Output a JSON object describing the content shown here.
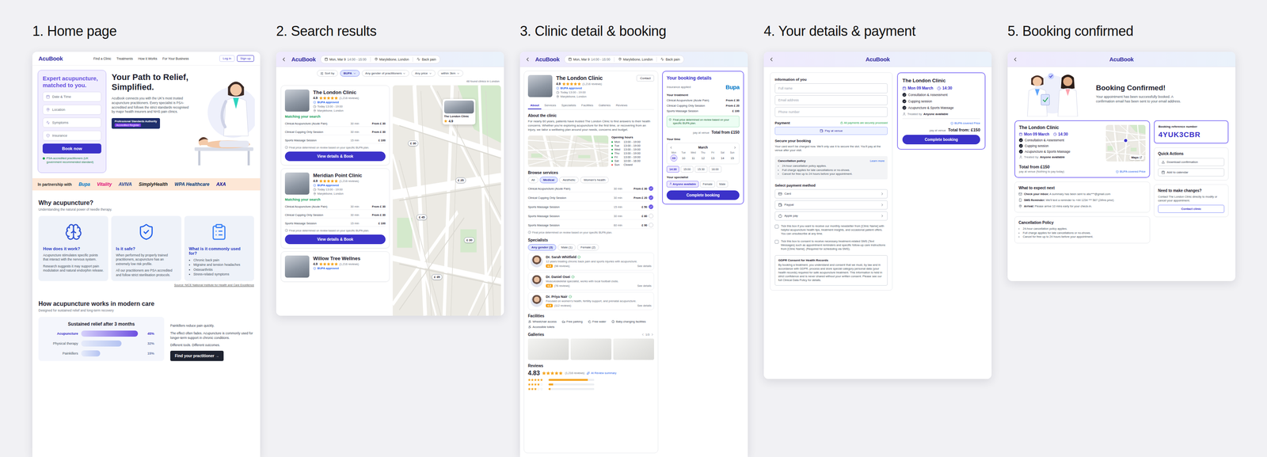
{
  "steps": [
    "1. Home page",
    "2. Search results",
    "3. Clinic detail & booking",
    "4. Your details & payment",
    "5. Booking confirmed"
  ],
  "logo": "AcuBook",
  "home": {
    "nav": [
      "Find a Clinic",
      "Treatments",
      "How it Works",
      "For Your Business"
    ],
    "login": "Log in",
    "signup": "Sign up",
    "search_card": {
      "title": "Expert acupuncture, matched to you.",
      "fields": [
        "Date & Time",
        "Location",
        "Symptoms",
        "Insurance"
      ],
      "button": "Book now",
      "note": "PSA-accredited practitioners (UK government recommended standard)"
    },
    "hero": {
      "title": "Your Path to Relief, Simplified.",
      "text": "AcuBook connects you with the UK's most trusted acupuncture practitioners. Every specialist is PSA-accredited and follows the strict standards recognised by major health insurers and NHS pain clinics.",
      "badge_top": "Professional Standards Authority",
      "badge_bottom": "Accredited Register"
    },
    "partners": {
      "label": "In partnership with",
      "logos": [
        {
          "name": "Bupa",
          "color": "#0079c8"
        },
        {
          "name": "Vitality",
          "color": "#e0147c"
        },
        {
          "name": "AVIVA",
          "color": "#1d3f8f"
        },
        {
          "name": "SimplyHealth",
          "color": "#222222"
        },
        {
          "name": "WPA Healthcare",
          "color": "#0a3d7a"
        },
        {
          "name": "AXA",
          "color": "#00008f"
        }
      ]
    },
    "why": {
      "title": "Why acupuncture?",
      "subtitle": "Understanding the natural power of needle therapy.",
      "cards": [
        {
          "title": "How does it work?",
          "kind": "text",
          "paragraphs": [
            "Acupuncture stimulates specific points that interact with the nervous system.",
            "Research suggests it may support pain modulation and natural endorphin release."
          ]
        },
        {
          "title": "Is it safe?",
          "kind": "text",
          "paragraphs": [
            "When performed by properly trained practitioners, acupuncture has an extremely low risk profile.",
            "All our practitioners are PSA accredited and follow strict sterilisation protocols."
          ]
        },
        {
          "title": "What is it commonly used for?",
          "kind": "list",
          "paragraphs": [
            "Chronic back pain",
            "Migraine and tension headaches",
            "Osteoarthritis",
            "Stress-related symptoms"
          ]
        }
      ],
      "source": "Source: NICE National Institute for Health and Care Excellence"
    },
    "care": {
      "title": "How acupuncture works in modern care",
      "subtitle": "Designed for sustained relief and long-term recovery",
      "chart": {
        "title": "Sustained relief after 3 months",
        "series": [
          {
            "label": "Acupuncture",
            "values": [
              45
            ],
            "reading": "45%",
            "highlight": true
          },
          {
            "label": "Physical therapy",
            "values": [
              32
            ],
            "reading": "32%",
            "highlight": false
          },
          {
            "label": "Painkillers",
            "values": [
              15
            ],
            "reading": "15%",
            "highlight": false
          }
        ]
      },
      "paragraphs": [
        "Painkillers reduce pain quickly.",
        "The effect often fades. Acupuncture is commonly used for longer-term support in chronic conditions.",
        "Different tools. Different outcomes."
      ],
      "button": "Find your practitioner →"
    }
  },
  "search": {
    "query": {
      "date": "Mon, Mar 9",
      "time": "14:00 - 15:00",
      "location": "Marylebone, London",
      "symptom": "Back pain"
    },
    "filters": [
      {
        "label": "Sort by",
        "selected": false
      },
      {
        "label": "BUPA",
        "selected": true
      },
      {
        "label": "Any gender of practitioners",
        "selected": false
      },
      {
        "label": "Any price",
        "selected": false
      },
      {
        "label": "within 3km",
        "selected": false
      }
    ],
    "count": "48 found clinics in London",
    "clinics": [
      {
        "kind": "full",
        "name": "The London Clinic",
        "rating": "4.9",
        "stars": 5,
        "reviews": "(1,216 reviews)",
        "badge": "BUPA approved",
        "hours": "Today 13:00 - 19:00",
        "location": "Marylebone, London",
        "match": "Matching your search",
        "services": [
          {
            "name": "Clinical Acupuncture (Acute Pain)",
            "duration": "30 min",
            "price": "From £ 30"
          },
          {
            "name": "Clinical Cupping Only Session",
            "duration": "30 min",
            "price": "From £ 30"
          },
          {
            "name": "Sports Massage Session",
            "duration": "15 min",
            "price": "£ 100"
          }
        ],
        "note": "Final price determined on review based on your specific BUPA plan.",
        "button": "View details & Book"
      },
      {
        "kind": "full",
        "name": "Meridian Point Clinic",
        "rating": "4.9",
        "stars": 5,
        "reviews": "(1,216 reviews)",
        "badge": "BUPA approved",
        "hours": "Today 13:00 - 19:00",
        "location": "Marylebone, London",
        "match": "Matching your search",
        "services": [
          {
            "name": "Clinical Acupuncture (Acute Pain)",
            "duration": "30 min",
            "price": "From £ 30"
          },
          {
            "name": "Clinical Cupping Only Session",
            "duration": "30 min",
            "price": "From £ 30"
          },
          {
            "name": "Sports Massage Session",
            "duration": "15 min",
            "price": "£ 100"
          }
        ],
        "note": "Final price determined on review based on your specific BUPA plan.",
        "button": "View details & Book"
      },
      {
        "kind": "partial",
        "name": "Willow Tree Wellnes",
        "rating": "4.9",
        "stars": 5,
        "reviews": "(1,216 reviews)",
        "badge": "BUPA approved"
      }
    ],
    "map": {
      "pins": [
        "£ 30",
        "£ 25",
        "£ 45",
        "£ 30",
        "£ 35"
      ],
      "popup": {
        "name": "The London Clinic",
        "rating": "4.9"
      }
    }
  },
  "detail": {
    "query": {
      "date": "Mon, Mar 9",
      "time": "14:00 - 15:00",
      "location": "Marylebone, London",
      "symptom": "Back pain"
    },
    "clinic": {
      "name": "The London Clinic",
      "rating": "4.9",
      "stars": 5,
      "reviews": "(1,216 reviews)",
      "badge": "BUPA approved",
      "hours": "Today 13:00 - 19:00",
      "location": "Marylebone, London"
    },
    "contact": "Contact",
    "tabs": [
      {
        "label": "About",
        "selected": true
      },
      {
        "label": "Services",
        "selected": false
      },
      {
        "label": "Specialists",
        "selected": false
      },
      {
        "label": "Facilities",
        "selected": false
      },
      {
        "label": "Galleries",
        "selected": false
      },
      {
        "label": "Reviews",
        "selected": false
      }
    ],
    "about": {
      "title": "About the clinic",
      "text": "For nearly 60 years, patients have trusted The London Clinic to find answers to their health concerns. Whether you're exploring acupuncture for the first time, or recovering from an injury, we tailor a wellbeing plan around your needs, concerns and budget."
    },
    "hours_title": "Opening hours",
    "hours": [
      {
        "day": "Mon",
        "time": "13:00 - 19:00"
      },
      {
        "day": "Tue",
        "time": "13:00 - 19:00"
      },
      {
        "day": "Wed",
        "time": "13:00 - 19:00"
      },
      {
        "day": "Thu",
        "time": "13:00 - 19:00"
      },
      {
        "day": "Fri",
        "time": "13:00 - 19:00"
      },
      {
        "day": "Sat",
        "time": "10:00 - 16:00"
      },
      {
        "day": "Sun",
        "time": "Closed"
      }
    ],
    "services": {
      "title": "Browse services",
      "chips": [
        {
          "label": "All",
          "selected": false
        },
        {
          "label": "Medical",
          "selected": true
        },
        {
          "label": "Aesthetic",
          "selected": false
        },
        {
          "label": "Women's health",
          "selected": false
        }
      ],
      "items": [
        {
          "name": "Clinical Acupuncture (Acute Pain)",
          "duration": "30 min",
          "price": "From £ 30",
          "checked": true
        },
        {
          "name": "Clinical Cupping Only Session",
          "duration": "30 min",
          "price": "From £ 20",
          "checked": true
        },
        {
          "name": "Sports Massage Session",
          "duration": "15 min",
          "price": "£ 50",
          "checked": true
        },
        {
          "name": "Sports Massage Session",
          "duration": "30 min",
          "price": "£ 80",
          "checked": false
        },
        {
          "name": "Sports Massage Session",
          "duration": "60 min",
          "price": "£ 90",
          "checked": false
        }
      ],
      "note": "Final price determined on review based on your specific BUPA plan."
    },
    "specialists": {
      "title": "Specialists",
      "chips": [
        {
          "label": "Any gender (3)",
          "selected": true
        },
        {
          "label": "Male (1)",
          "selected": false
        },
        {
          "label": "Female (2)",
          "selected": false
        }
      ],
      "people": [
        {
          "name": "Dr. Sarah Whitfield",
          "bio": "12 years treating chronic back pain and sports injuries with acupuncture.",
          "rating": "4.9",
          "reviews": "(98 reviews)",
          "link": "See details"
        },
        {
          "name": "Dr. Daniel Osei",
          "bio": "Musculoskeletal specialist, works with local football clubs.",
          "rating": "4.8",
          "reviews": "(76 reviews)",
          "link": "See details"
        },
        {
          "name": "Dr. Priya Nair",
          "bio": "Focused on women's health, fertility support, and prenatal acupuncture.",
          "rating": "4.9",
          "reviews": "(112 reviews)",
          "link": "See details"
        }
      ]
    },
    "facilities": {
      "title": "Facilities",
      "items": [
        "Wheelchair access",
        "Free parking",
        "Free water",
        "Baby changing facilities",
        "Accessible toilets"
      ]
    },
    "galleries": {
      "title": "Galleries",
      "pager": "1/3",
      "photos": 3
    },
    "reviews": {
      "title": "Reviews",
      "score": "4.83",
      "stars": 5,
      "count": "(1,216 reviews)",
      "summary": "AI Review summary",
      "bars": [
        {
          "stars": 5,
          "level": 0.86
        },
        {
          "stars": 4,
          "level": 0.1
        },
        {
          "stars": 3,
          "level": 0.04
        }
      ]
    },
    "booking": {
      "title": "Your booking details",
      "insurance_label": "Insurance applied",
      "insurer": "Bupa",
      "treatment_label": "Your treatment",
      "items": [
        {
          "name": "Clinical Acupuncture (Acute Pain)",
          "price": "From £ 30"
        },
        {
          "name": "Clinical Cupping Only Session",
          "price": "From £ 20"
        },
        {
          "name": "Sports Massage Session",
          "price": "£ 100"
        }
      ],
      "info": "Final price determined on review based on your specific BUPA plan.",
      "pay": "pay at venue",
      "total": "Total from £150",
      "time_label": "Your time",
      "month": "March",
      "days": [
        {
          "day": "Mon",
          "date": "09",
          "selected": true
        },
        {
          "day": "Tue",
          "date": "10",
          "selected": false
        },
        {
          "day": "Wed",
          "date": "11",
          "selected": false
        },
        {
          "day": "Thu",
          "date": "12",
          "selected": false
        },
        {
          "day": "Fri",
          "date": "13",
          "selected": false
        },
        {
          "day": "Sat",
          "date": "14",
          "selected": false
        },
        {
          "day": "Sun",
          "date": "15",
          "selected": false
        }
      ],
      "times": [
        {
          "label": "14:30",
          "selected": true
        },
        {
          "label": "15:00",
          "selected": false
        },
        {
          "label": "15:30",
          "selected": false
        },
        {
          "label": "16:00",
          "selected": false
        }
      ],
      "specialist_label": "Your specialist",
      "specialists": [
        {
          "label": "Anyone available",
          "selected": true
        },
        {
          "label": "Female",
          "selected": false
        },
        {
          "label": "Male",
          "selected": false
        }
      ],
      "button": "Complete booking"
    }
  },
  "payment": {
    "info_title": "Information of you",
    "fields": [
      "Full name",
      "Email address",
      "Phone number"
    ],
    "payment_title": "Payment",
    "secure_note": "All payments are securely processed",
    "pay_option": "Pay at venue",
    "secure_title": "Secure your booking",
    "secure_text": "Your card won't be charged now. We'll only use it to secure the slot. You'll pay at the venue after your visit.",
    "policy": {
      "title": "Cancellation policy",
      "link": "Learn more",
      "items": [
        "24-hour cancellation policy applies.",
        "Full charge applies for late cancellations or no-shows.",
        "Cancel for free up to 24 hours before your appointment."
      ]
    },
    "method_title": "Select payment method",
    "methods": [
      "Card",
      "Paypal",
      "Apple pay"
    ],
    "consents": [
      {
        "text": "Tick this box if you want to receive our monthly newsletter from [Clinic Name] with helpful acupuncture health tips, treatment insights, and occasional patient offers. You can unsubscribe at any time.",
        "checked": false
      },
      {
        "text": "Tick this box to consent to receive necessary treatment-related SMS (Text Messages) such as appointment reminders and specific follow-up care instructions from [Clinic Name]. (Required for scheduling via SMS).",
        "checked": false
      }
    ],
    "gdpr": {
      "title": "GDPR Consent for Health Records",
      "text": "By booking a treatment, you understand and consent that we must, by law and in accordance with GDPR, process and store special category personal data (your health records) required for safe acupuncture treatment. This information is held in strict confidence and is never shared without your written consent. Please see our full Clinical Data Policy for details."
    },
    "summary": {
      "clinic": "The London Clinic",
      "date": "Mon 09 March",
      "time": "14:30",
      "items": [
        "Consultation & Assessment",
        "Cupping session",
        "Acupuncture & Sports Massage"
      ],
      "treated_label": "Treated by",
      "treated": "Anyone available",
      "covered": "BUPA covered Price",
      "pay": "pay at venue",
      "total": "Total from: £150",
      "button": "Complete booking"
    }
  },
  "confirmed": {
    "title": "Booking Confirmed!",
    "text": "Your appointment has been successfully booked. A confirmation email has been sent to your email address.",
    "card": {
      "clinic": "The London Clinic",
      "date": "Mon 09 March",
      "time": "14:30",
      "items": [
        "Consultation & Assessment",
        "Cupping session",
        "Acupuncture & Sports Massage"
      ],
      "treated_label": "Treated by",
      "treated": "Anyone available",
      "maps": "Maps",
      "total": "Total from £150",
      "pay": "pay at venue (Nothing to pay today)",
      "covered": "BUPA covered Price"
    },
    "reference": {
      "label": "Booking reference number",
      "code": "4YUK3CBR"
    },
    "quick": {
      "title": "Quick Actions",
      "actions": [
        "Download confirmation",
        "Add to calendar"
      ]
    },
    "next": {
      "title": "What to expect next",
      "items": [
        {
          "label": "Check your inbox:",
          "text": "A summary has been sent to abc***@gmail.com"
        },
        {
          "label": "SMS Reminder:",
          "text": "We'll text a reminder to +44 1234 *** 567 (24hrs prior)"
        },
        {
          "label": "Arrival:",
          "text": "Please arrive 10 mins early for your check-in."
        }
      ]
    },
    "changes": {
      "title": "Need to make changes?",
      "text": "Contact The London Clinic directly to modify or cancel your appointment.",
      "button": "Contact clinic"
    },
    "policy": {
      "title": "Cancellation Policy",
      "items": [
        "24-hour cancellation policy applies.",
        "Full charge applies for late cancellations or no-shows.",
        "Cancel for free up to 24 hours before your appointment."
      ]
    }
  }
}
